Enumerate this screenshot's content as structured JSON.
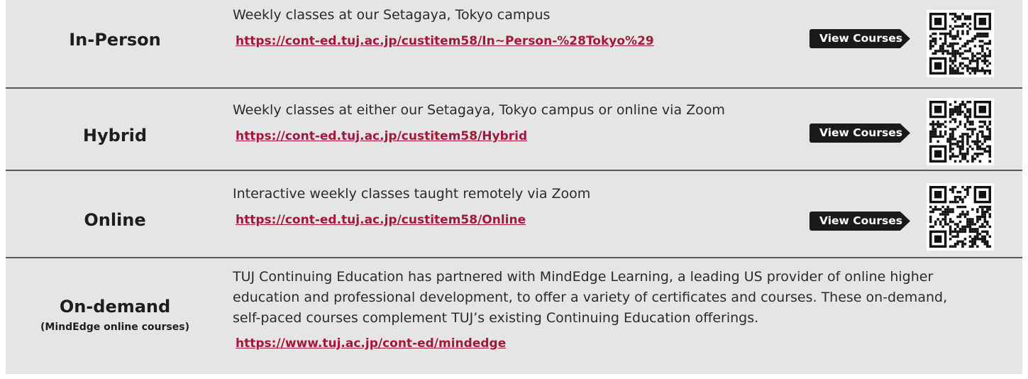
{
  "rows": [
    {
      "mode": "In-Person",
      "description": "Weekly classes at our Setagaya, Tokyo campus",
      "url": "https://cont-ed.tuj.ac.jp/custitem58/In~Person-%28Tokyo%29",
      "button": "View Courses",
      "qr_icon": "qr-code-icon"
    },
    {
      "mode": "Hybrid",
      "description": "Weekly classes at either our Setagaya, Tokyo campus or online via Zoom",
      "url": "https://cont-ed.tuj.ac.jp/custitem58/Hybrid",
      "button": "View Courses",
      "qr_icon": "qr-code-icon"
    },
    {
      "mode": "Online",
      "description": "Interactive weekly classes taught remotely via Zoom",
      "url": "https://cont-ed.tuj.ac.jp/custitem58/Online",
      "button": "View Courses",
      "qr_icon": "qr-code-icon"
    },
    {
      "mode": "On-demand",
      "subtitle": "(MindEdge online courses)",
      "description_lines": [
        "TUJ Continuing Education has partnered with MindEdge Learning, a leading US provider of online higher",
        "education and professional development, to offer a variety of certificates and courses. These on-demand,",
        "self-paced courses complement TUJ’s existing Continuing Education offerings."
      ],
      "url": "https://www.tuj.ac.jp/cont-ed/mindedge"
    }
  ],
  "colors": {
    "background": "#e5e5e5",
    "link": "#a4173a",
    "button": "#1a1a1a",
    "divider": "#5a5a5a"
  }
}
